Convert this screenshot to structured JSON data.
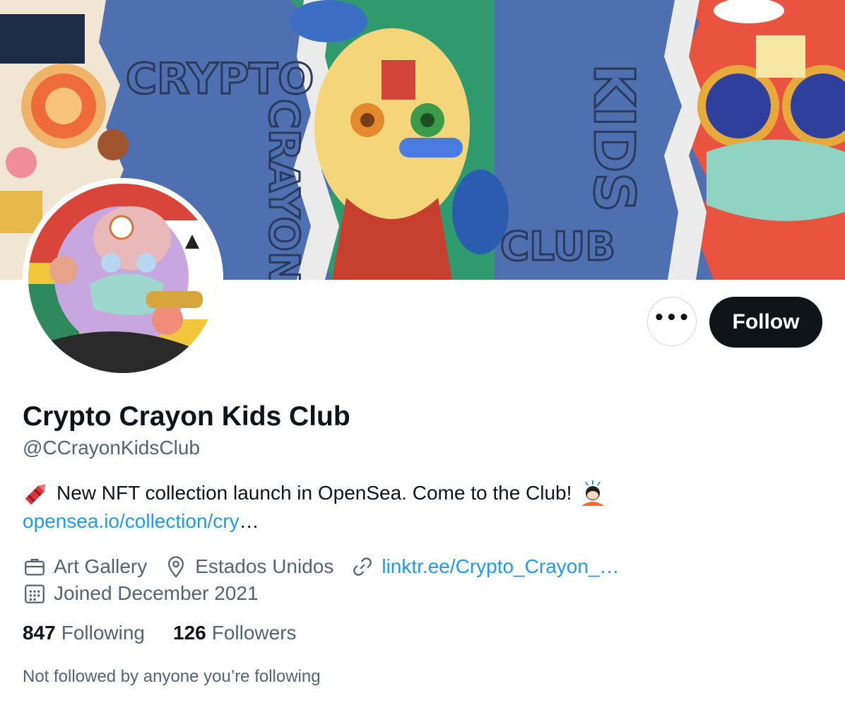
{
  "banner": {
    "text_left_line1": "CRYPTO",
    "text_left_line2": "CRAYON",
    "text_right_line1": "KIDS",
    "text_right_line2": "CLUB"
  },
  "actions": {
    "more_label": "•••",
    "follow_label": "Follow"
  },
  "profile": {
    "display_name": "Crypto Crayon Kids Club",
    "handle": "@CCrayonKidsClub",
    "bio_text": "New NFT collection launch in OpenSea. Come to the Club!",
    "bio_link": "opensea.io/collection/cry",
    "bio_link_ellipsis": "…",
    "category": "Art Gallery",
    "location": "Estados Unidos",
    "website": "linktr.ee/Crypto_Crayon_…",
    "joined": "Joined December 2021"
  },
  "stats": {
    "following_count": "847",
    "following_label": "Following",
    "followers_count": "126",
    "followers_label": "Followers"
  },
  "social_context": "Not followed by anyone you’re following",
  "colors": {
    "accent": "#1d9bf0",
    "text_primary": "#0f1419",
    "text_secondary": "#536471",
    "banner_blue": "#4e6fb0"
  },
  "icons": {
    "bio_start": "crayon-emoji",
    "bio_end": "person-bowing-emoji",
    "category": "briefcase-icon",
    "location": "location-pin-icon",
    "website": "link-icon",
    "joined": "calendar-icon"
  }
}
